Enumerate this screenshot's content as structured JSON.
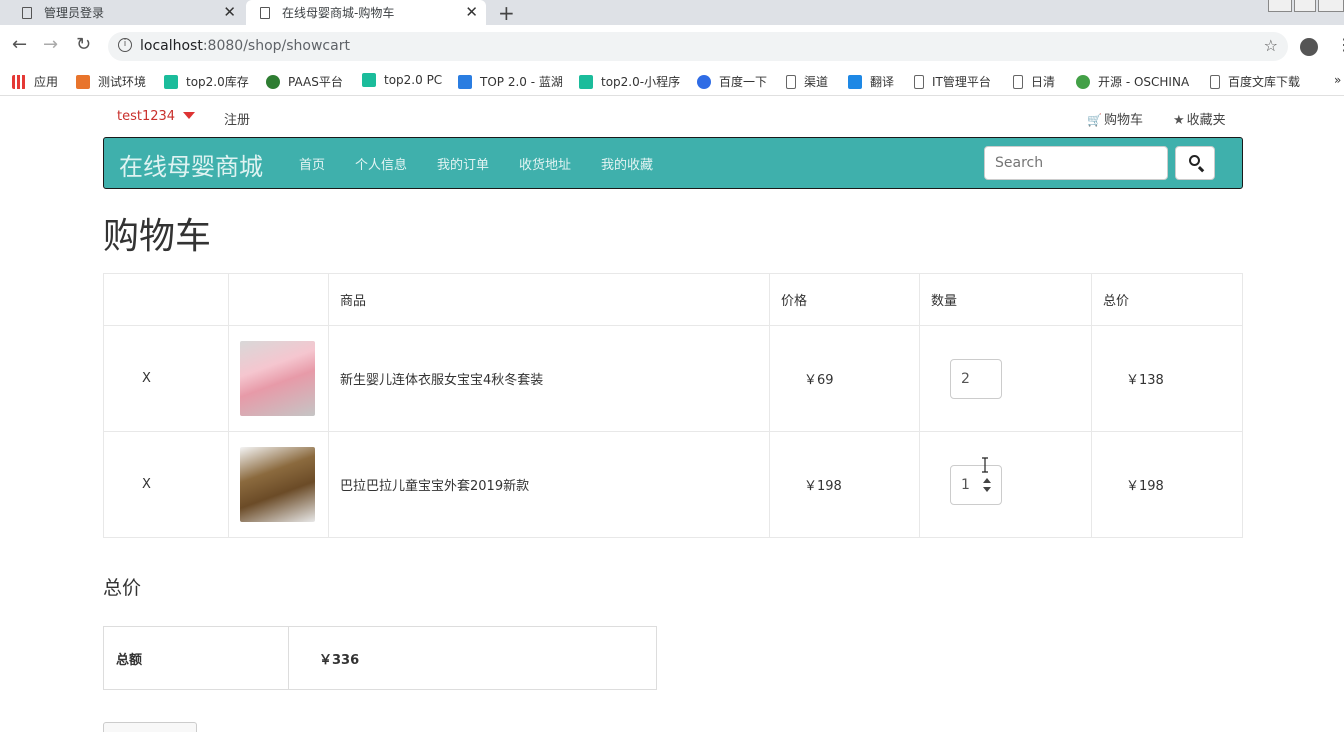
{
  "browser": {
    "tabs": [
      {
        "title": "管理员登录"
      },
      {
        "title": "在线母婴商城-购物车"
      }
    ],
    "url_host": "localhost",
    "url_rest": ":8080/shop/showcart",
    "bookmarks": [
      {
        "label": "应用",
        "icon": "apps-icon"
      },
      {
        "label": "测试环境",
        "icon": "u-icon"
      },
      {
        "label": "top2.0库存",
        "icon": "play-icon"
      },
      {
        "label": "PAAS平台",
        "icon": "globe-icon"
      },
      {
        "label": "top2.0 PC",
        "icon": "play-icon"
      },
      {
        "label": "TOP 2.0 - 蓝湖",
        "icon": "lanhu-icon"
      },
      {
        "label": "top2.0-小程序",
        "icon": "play-icon"
      },
      {
        "label": "百度一下",
        "icon": "baidu-icon"
      },
      {
        "label": "渠道",
        "icon": "page-icon"
      },
      {
        "label": "翻译",
        "icon": "translate-icon"
      },
      {
        "label": "IT管理平台",
        "icon": "page-icon"
      },
      {
        "label": "日清",
        "icon": "page-icon"
      },
      {
        "label": "开源 - OSCHINA",
        "icon": "oschina-icon"
      },
      {
        "label": "百度文库下载",
        "icon": "page-icon"
      }
    ],
    "more": "»"
  },
  "topnav": {
    "user": "test1234",
    "register": "注册",
    "cart": "购物车",
    "favorites": "收藏夹"
  },
  "navbar": {
    "brand": "在线母婴商城",
    "items": [
      "首页",
      "个人信息",
      "我的订单",
      "收货地址",
      "我的收藏"
    ],
    "search_placeholder": "Search"
  },
  "page": {
    "title": "购物车",
    "table_headers": [
      "",
      "",
      "商品",
      "价格",
      "数量",
      "总价"
    ],
    "rows": [
      {
        "delete": "X",
        "name": "新生婴儿连体衣服女宝宝4秋冬套装",
        "price": "￥69",
        "qty": "2",
        "total": "￥138"
      },
      {
        "delete": "X",
        "name": "巴拉巴拉儿童宝宝外套2019新款",
        "price": "￥198",
        "qty": "1",
        "total": "￥198"
      }
    ],
    "summary_title": "总价",
    "summary_label": "总额",
    "summary_value": "￥336"
  },
  "colors": {
    "navbar": "#3fb0ac",
    "delete": "#e02020",
    "user": "#c9302c"
  }
}
